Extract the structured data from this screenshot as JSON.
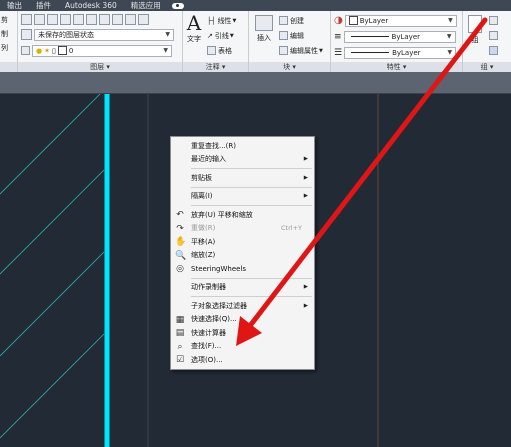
{
  "menu_tabs": [
    "输出",
    "插件",
    "Autodesk 360",
    "精选应用"
  ],
  "ribbon": {
    "left_stub": [
      "剪",
      "制",
      "列"
    ],
    "layers": {
      "state_combo": "未保存的图层状态",
      "layer_combo": "0",
      "title": "图层"
    },
    "annotation": {
      "text_button": "文字",
      "linear": "线性",
      "leader": "引线",
      "table": "表格",
      "title": "注释"
    },
    "block": {
      "insert_button": "插入",
      "create": "创建",
      "edit": "编辑",
      "edit_attributes": "编辑属性",
      "title": "块"
    },
    "properties": {
      "color": "ByLayer",
      "linetype": "ByLayer",
      "lineweight": "ByLayer",
      "title": "特性"
    },
    "groups": {
      "group_button": "组",
      "title": "组"
    }
  },
  "context_menu": {
    "items": [
      {
        "label": "重复查找...(R)",
        "icon": "",
        "submenu": false,
        "shortcut": "",
        "disabled": false
      },
      {
        "label": "最近的输入",
        "icon": "",
        "submenu": true,
        "shortcut": "",
        "disabled": false
      },
      {
        "sep": true
      },
      {
        "label": "剪贴板",
        "icon": "",
        "submenu": true,
        "shortcut": "",
        "disabled": false
      },
      {
        "sep": true
      },
      {
        "label": "隔离(I)",
        "icon": "",
        "submenu": true,
        "shortcut": "",
        "disabled": false
      },
      {
        "sep": true
      },
      {
        "label": "放弃(U) 平移和缩放",
        "icon": "undo-icon",
        "submenu": false,
        "shortcut": "",
        "disabled": false
      },
      {
        "label": "重做(R)",
        "icon": "redo-icon",
        "submenu": false,
        "shortcut": "Ctrl+Y",
        "disabled": true
      },
      {
        "label": "平移(A)",
        "icon": "pan-icon",
        "submenu": false,
        "shortcut": "",
        "disabled": false
      },
      {
        "label": "缩放(Z)",
        "icon": "zoom-icon",
        "submenu": false,
        "shortcut": "",
        "disabled": false
      },
      {
        "label": "SteeringWheels",
        "icon": "steeringwheel-icon",
        "submenu": false,
        "shortcut": "",
        "disabled": false
      },
      {
        "sep": true
      },
      {
        "label": "动作录制器",
        "icon": "",
        "submenu": true,
        "shortcut": "",
        "disabled": false
      },
      {
        "sep": true
      },
      {
        "label": "子对象选择过滤器",
        "icon": "",
        "submenu": true,
        "shortcut": "",
        "disabled": false
      },
      {
        "label": "快速选择(Q)...",
        "icon": "quick-select-icon",
        "submenu": false,
        "shortcut": "",
        "disabled": false
      },
      {
        "label": "快速计算器",
        "icon": "calculator-icon",
        "submenu": false,
        "shortcut": "",
        "disabled": false
      },
      {
        "label": "查找(F)...",
        "icon": "find-icon",
        "submenu": false,
        "shortcut": "",
        "disabled": false
      },
      {
        "label": "选项(O)...",
        "icon": "options-icon",
        "submenu": false,
        "shortcut": "",
        "disabled": false
      }
    ]
  },
  "colors": {
    "canvas": "#222a35",
    "cyan_line": "#00e5ff",
    "hatch": "#2fb3b0",
    "arrow": "#e01616"
  }
}
